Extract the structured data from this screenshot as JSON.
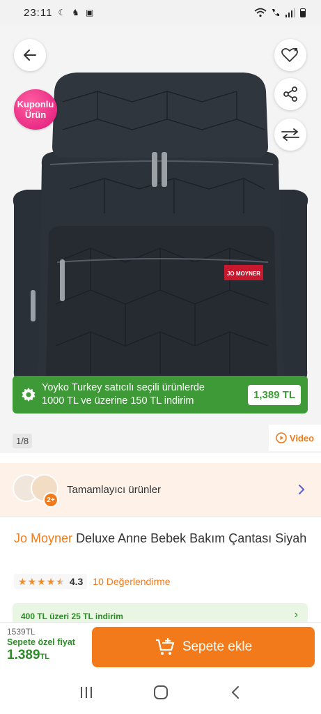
{
  "status_bar": {
    "time": "23:11",
    "icons": [
      "moon-icon",
      "notification-icon",
      "photo-icon",
      "wifi-icon",
      "call-icon",
      "signal-icon",
      "battery-icon"
    ]
  },
  "gallery": {
    "coupon_badge": {
      "line1": "Kuponlu",
      "line2": "Ürün"
    },
    "brand_tag": "JO MOYNER",
    "promo": {
      "text_line1": "Yoyko Turkey satıcılı seçili ürünlerde",
      "text_line2": "1000 TL ve üzerine 150 TL indirim",
      "price": "1,389 TL"
    },
    "page_indicator": "1/8",
    "video_label": "Video"
  },
  "complementary": {
    "count": "2+",
    "label": "Tamamlayıcı ürünler"
  },
  "product": {
    "brand": "Jo Moyner",
    "name": "Deluxe Anne Bebek Bakım Çantası Siyah",
    "rating": 4.3,
    "rating_text": "4.3",
    "reviews": "10 Değerlendirme"
  },
  "banner": {
    "text": "400 TL üzeri 25 TL indirim"
  },
  "bottom_bar": {
    "old_price": "1539TL",
    "special_label": "Sepete özel fiyat",
    "special_price": "1.389",
    "currency": "TL",
    "cart_label": "Sepete ekle"
  },
  "colors": {
    "accent": "#f27a1a",
    "green": "#3d9a37",
    "pink": "#e0157a"
  }
}
